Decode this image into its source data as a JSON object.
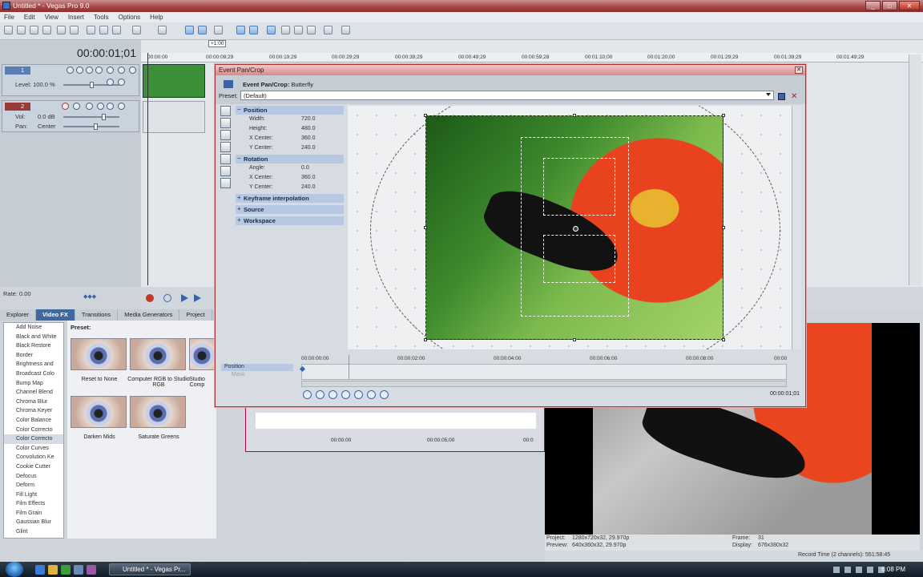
{
  "app": {
    "title": "Untitled * - Vegas Pro 9.0",
    "window_buttons": [
      "_",
      "□",
      "✕"
    ]
  },
  "menu": [
    "File",
    "Edit",
    "View",
    "Insert",
    "Tools",
    "Options",
    "Help"
  ],
  "timeline": {
    "timecode": "00:00:01;01",
    "ruler": [
      "00:00:00",
      "00:00:09;29",
      "00:00:19;29",
      "00:00:29;29",
      "00:00:39;29",
      "00:00:49;29",
      "00:00:59;28",
      "00:01:10;00",
      "00:01:20;00",
      "00:01:29;29",
      "00:01:39;29",
      "00:01:49;29"
    ],
    "cursor_label": "+1:00",
    "rate_label": "Rate: 0.00"
  },
  "tracks": [
    {
      "num": "1",
      "type": "video",
      "level_label": "Level: 100.0 %"
    },
    {
      "num": "2",
      "type": "audio",
      "vol_label": "Vol:",
      "vol_value": "0.0 dB",
      "pan_label": "Pan:",
      "pan_value": "Center"
    }
  ],
  "docktabs": [
    {
      "label": "Explorer",
      "active": false
    },
    {
      "label": "Video FX",
      "active": true
    },
    {
      "label": "Transitions",
      "active": false
    },
    {
      "label": "Media Generators",
      "active": false
    },
    {
      "label": "Project",
      "active": false
    }
  ],
  "fx_list": [
    "Add Noise",
    "Black and White",
    "Black Restore",
    "Border",
    "Brightness and",
    "Broadcast Colo",
    "Bump Map",
    "Channel Blend",
    "Chroma Blur",
    "Chroma Keyer",
    "Color Balance",
    "Color Correcto",
    "Color Correcto",
    "Color Curves",
    "Convolution Ke",
    "Cookie Cutter",
    "Defocus",
    "Deform",
    "Fill Light",
    "Film Effects",
    "Film Grain",
    "Gaussian Blur",
    "Glint"
  ],
  "fx_selected_index": 12,
  "preset_pane": {
    "label": "Preset:",
    "items": [
      {
        "label": "Reset to None"
      },
      {
        "label": "Computer RGB to Studio RGB"
      },
      {
        "label": "Studio Comp"
      },
      {
        "label": "Darken Mids"
      },
      {
        "label": "Saturate Greens"
      }
    ]
  },
  "dialog": {
    "title": "Event Pan/Crop",
    "close": "✕",
    "event_label": "Event Pan/Crop:",
    "event_name": "Butterfly",
    "preset_label": "Preset:",
    "preset_value": "(Default)",
    "sections": {
      "position": {
        "title": "Position",
        "rows": [
          {
            "name": "Width:",
            "value": "720.0"
          },
          {
            "name": "Height:",
            "value": "480.0"
          },
          {
            "name": "X Center:",
            "value": "360.0"
          },
          {
            "name": "Y Center:",
            "value": "240.0"
          }
        ]
      },
      "rotation": {
        "title": "Rotation",
        "rows": [
          {
            "name": "Angle:",
            "value": "0.0"
          },
          {
            "name": "X Center:",
            "value": "360.0"
          },
          {
            "name": "Y Center:",
            "value": "240.0"
          }
        ]
      },
      "collapsed": [
        "Keyframe interpolation",
        "Source",
        "Workspace"
      ]
    },
    "keyframes": {
      "track_label": "Position",
      "mask_label": "Mask",
      "ruler": [
        "00:00:00:00",
        "00:00:02:00",
        "00:00:04:00",
        "00:00:06:00",
        "00:00:08:00",
        "00:00"
      ],
      "timecode": "00:00:01;01"
    }
  },
  "trimmer": {
    "ruler": [
      "00:00:00",
      "00:00:05;00",
      "00:0"
    ]
  },
  "preview": {
    "project_label": "Project:",
    "project_value": "1280x720x32, 29.970p",
    "preview_label": "Preview:",
    "preview_value": "640x360x32, 29.970p",
    "frame_label": "Frame:",
    "frame_value": "31",
    "display_label": "Display:",
    "display_value": "676x380x32"
  },
  "status": {
    "record_time": "Record Time (2 channels): 551:58:45"
  },
  "taskbar": {
    "task_label": "Untitled * - Vegas Pr...",
    "clock": "6:08 PM"
  }
}
